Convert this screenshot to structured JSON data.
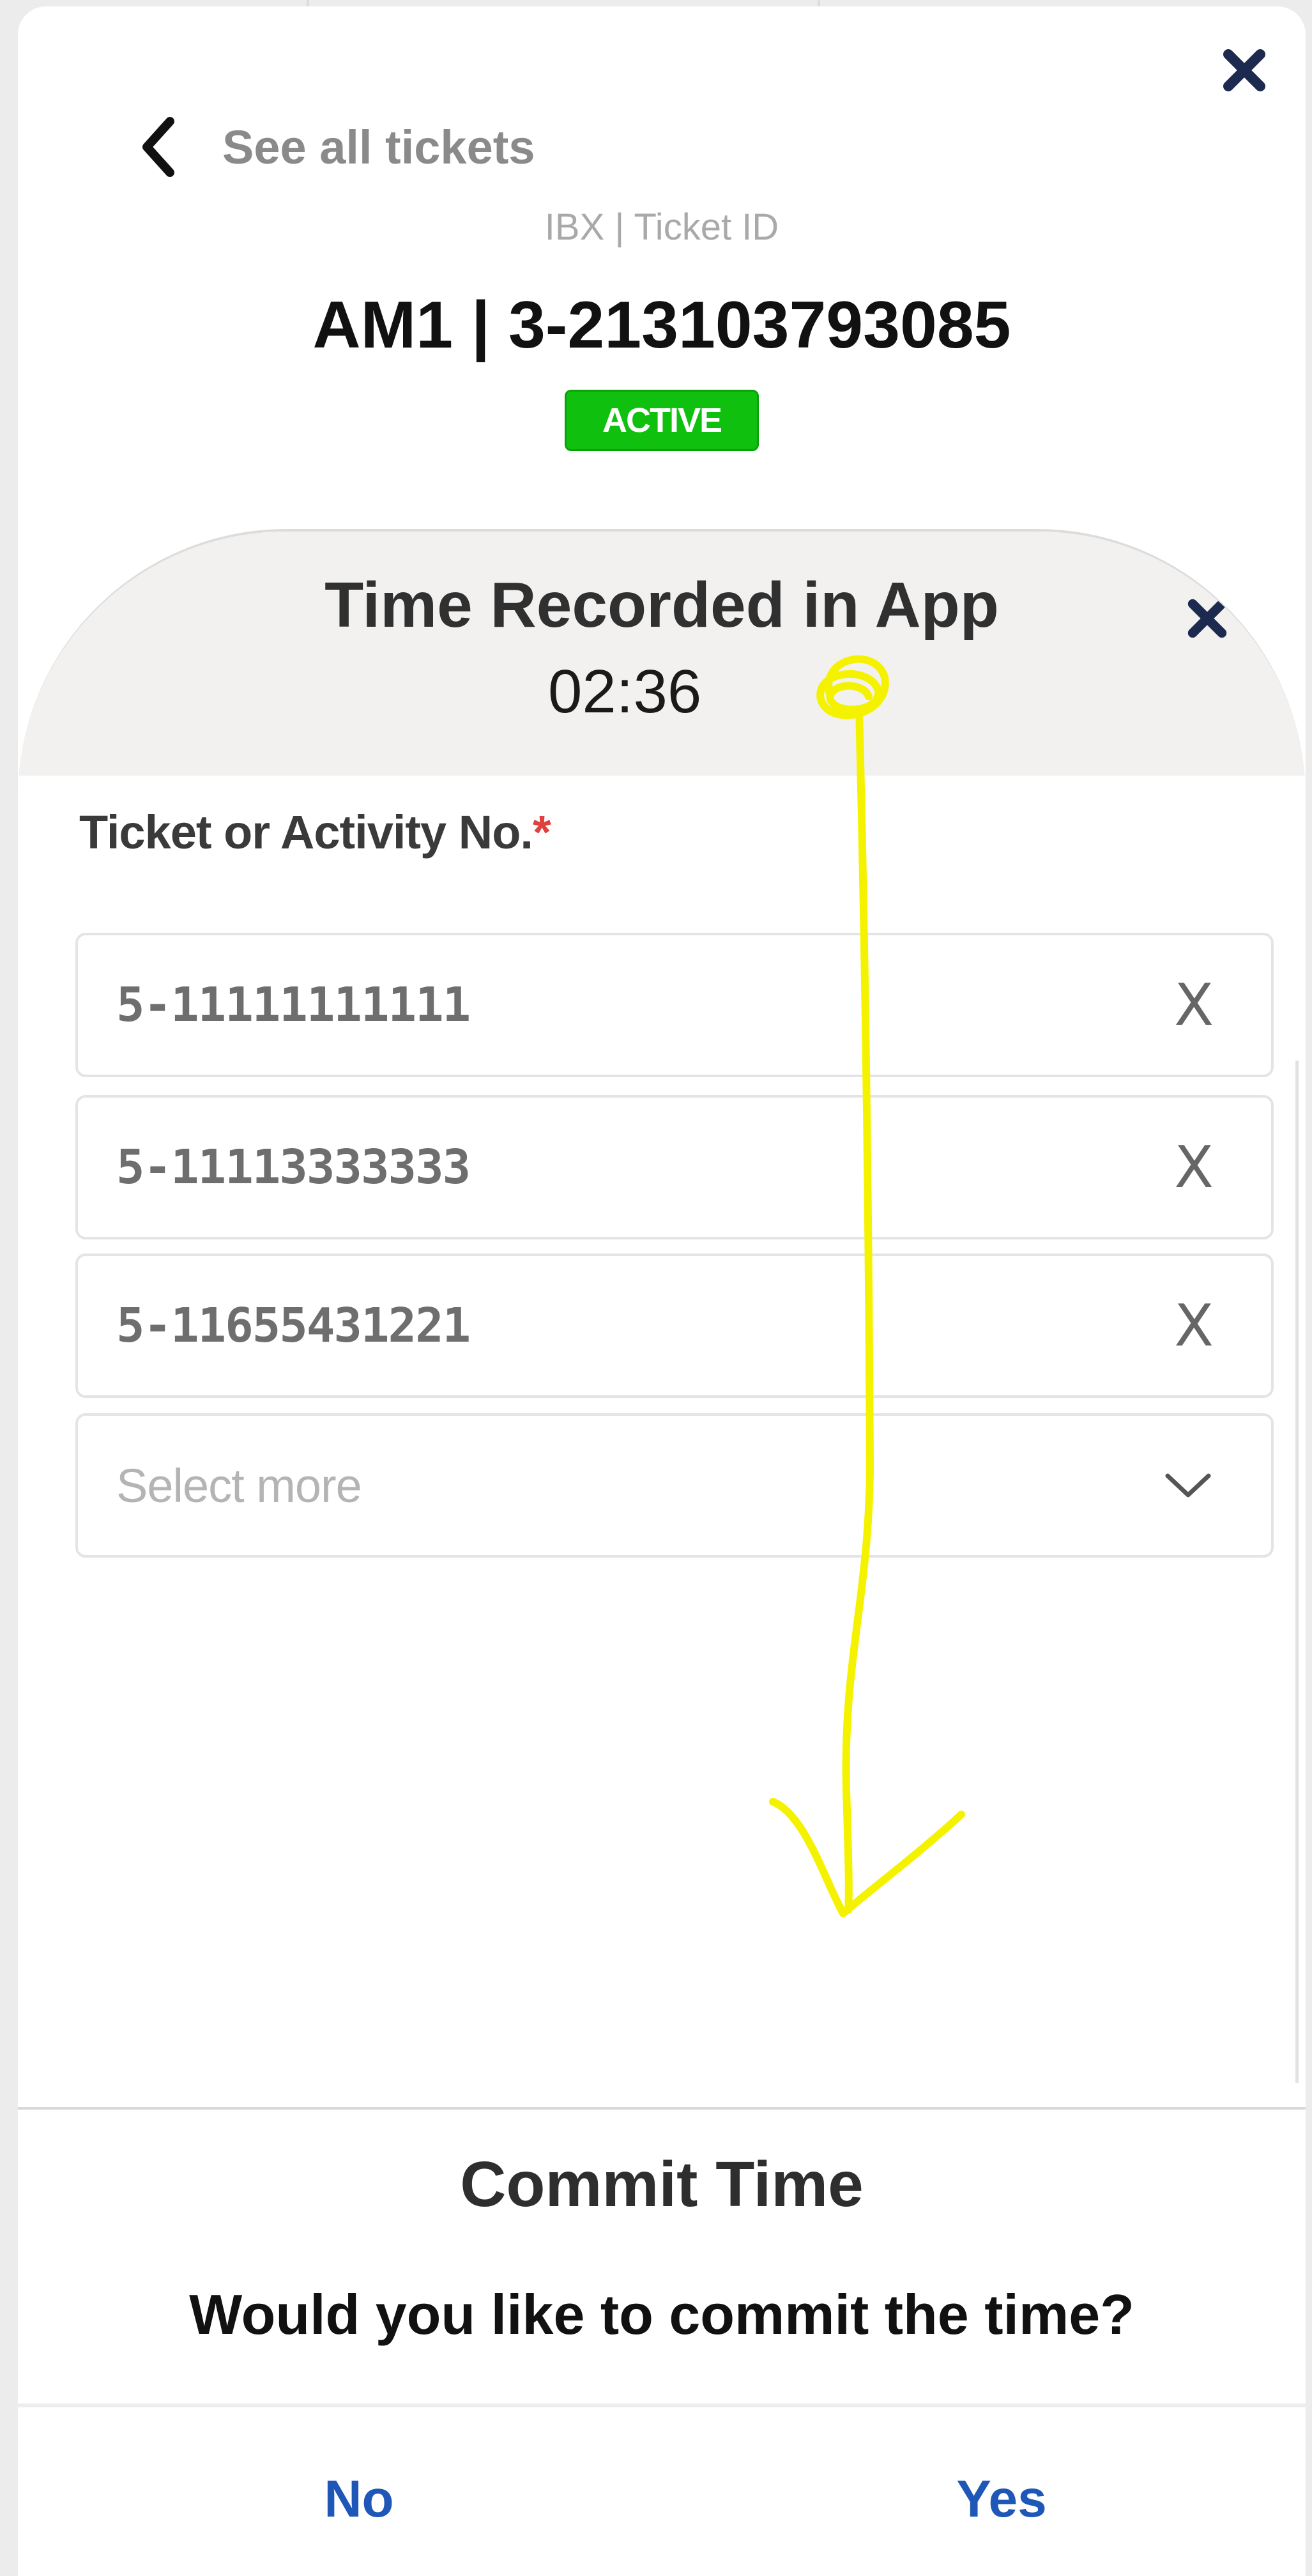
{
  "header": {
    "back_label": "See all tickets",
    "ibx_label": "IBX | Ticket ID",
    "ticket_title": "AM1 | 3-213103793085",
    "status_badge": "ACTIVE"
  },
  "time_sheet": {
    "title": "Time Recorded in App",
    "time_value": "02:36",
    "field_label": "Ticket or Activity No.",
    "required_mark": "*",
    "selected_items": [
      {
        "value": "5-11111111111",
        "remove": "X"
      },
      {
        "value": "5-11113333333",
        "remove": "X"
      },
      {
        "value": "5-11655431221",
        "remove": "X"
      }
    ],
    "select_placeholder": "Select more"
  },
  "commit_dialog": {
    "title": "Commit Time",
    "question": "Would you like to commit the time?",
    "no_label": "No",
    "yes_label": "Yes"
  },
  "colors": {
    "badge_green": "#0fc00f",
    "button_blue": "#1f57b8",
    "close_navy": "#1c2a4f",
    "annotation_yellow": "#f5f200"
  },
  "icons": {
    "close": "close-icon",
    "back": "chevron-left-icon",
    "dropdown": "chevron-down-icon"
  }
}
